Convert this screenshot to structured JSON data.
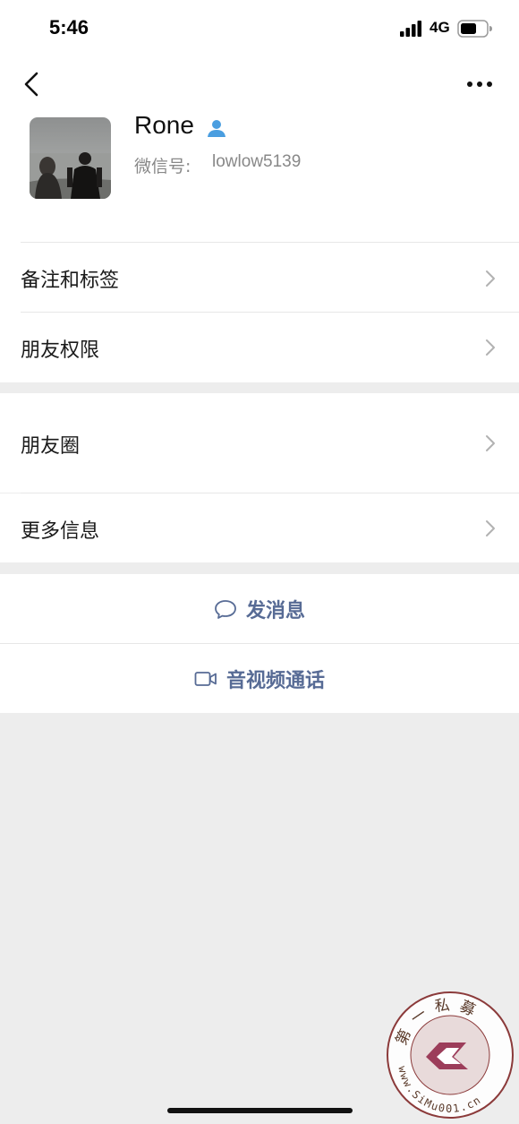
{
  "status_bar": {
    "time": "5:46",
    "network": "4G"
  },
  "nav": {
    "back_icon": "chevron-left-icon",
    "more_icon": "ellipsis-icon"
  },
  "profile": {
    "name": "Rone",
    "wechat_id_label": "微信号:",
    "wechat_id": "lowlow5139",
    "badge_icon": "contact-person-icon"
  },
  "settings_group_1": [
    {
      "label": "备注和标签"
    },
    {
      "label": "朋友权限"
    }
  ],
  "settings_group_2": [
    {
      "label": "朋友圈"
    },
    {
      "label": "更多信息"
    }
  ],
  "actions": {
    "message_label": "发消息",
    "message_icon": "chat-bubble-icon",
    "call_label": "音视频通话",
    "call_icon": "video-camera-icon"
  },
  "watermark": {
    "top_text": "第一私募",
    "bottom_text": "www.SiMu001.cn"
  },
  "colors": {
    "link_blue": "#576b95",
    "badge_blue": "#4a9ee0",
    "background": "#ededed"
  }
}
